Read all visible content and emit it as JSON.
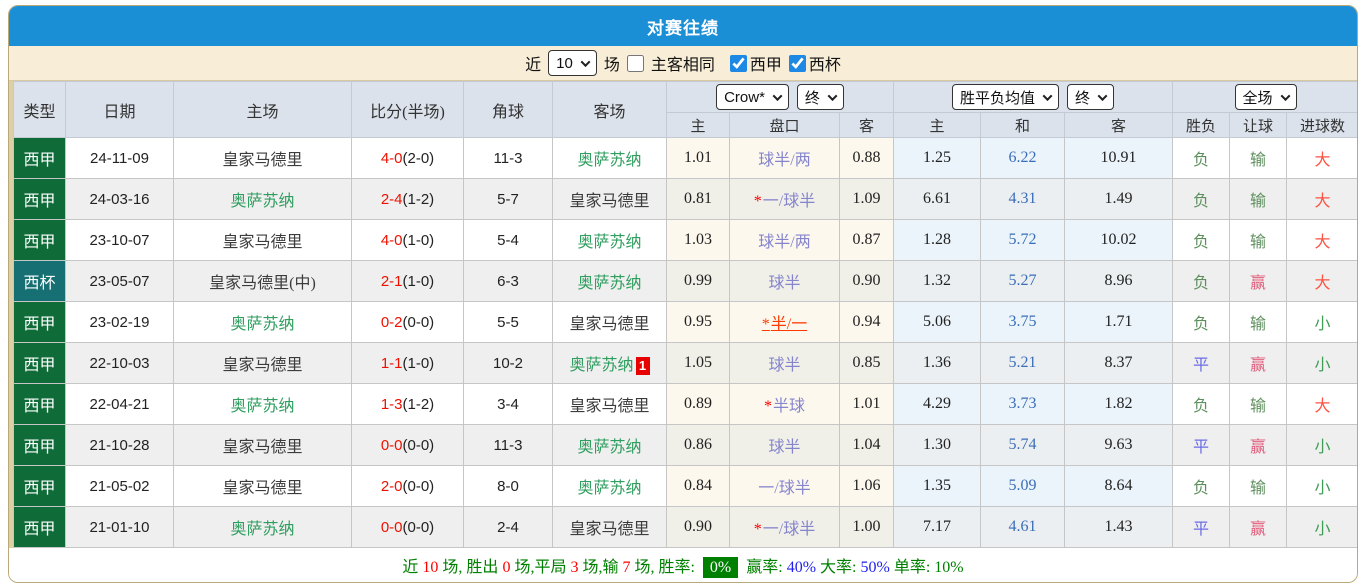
{
  "title": "对赛往绩",
  "colors": {
    "header_bar": "#1b8fd6",
    "filter_bar_bg": "#f8eed8",
    "liga_green": "#0f6c39",
    "cup_teal": "#166f73",
    "score_red": "#ee1100",
    "osasuna_green": "#2f9e5f",
    "handicap_purple": "#8585cd",
    "handicap_changed_red": "#ff3b00",
    "draw_avg_blue": "#3a6db8",
    "win_rate_badge_bg": "#008000"
  },
  "icons": {
    "dropdown_arrow": "chevron-down"
  },
  "filter": {
    "near_label": "近",
    "games_value": "10",
    "games_label": "场",
    "same_venue_label": "主客相同",
    "same_venue_checked": false,
    "league_label": "西甲",
    "league_checked": true,
    "cup_label": "西杯",
    "cup_checked": true
  },
  "table": {
    "left_headers": [
      "类型",
      "日期",
      "主场",
      "比分(半场)",
      "角球",
      "客场"
    ],
    "sub_headers": [
      "主",
      "盘口",
      "客",
      "主",
      "和",
      "客",
      "胜负",
      "让球",
      "进球数"
    ],
    "dropdowns": {
      "bookmaker": "Crow*",
      "bookmaker_state": "终",
      "avg": "胜平负均值",
      "avg_state": "终",
      "period": "全场"
    },
    "rows": [
      {
        "type": "西甲",
        "type_cls": "liga",
        "date": "24-11-09",
        "home": "皇家马德里",
        "home_cls": "black",
        "score": "4-0",
        "half": "(2-0)",
        "corner": "11-3",
        "away": "奥萨苏纳",
        "away_cls": "green",
        "red_card": "",
        "odds_home": "1.01",
        "line": "球半/两",
        "line_star": false,
        "line_changed": false,
        "odds_away": "0.88",
        "avg_home": "1.25",
        "avg_draw": "6.22",
        "avg_away": "10.91",
        "wl": "负",
        "wl_cls": "green",
        "let": "输",
        "let_cls": "green",
        "goal": "大",
        "goal_cls": "big"
      },
      {
        "type": "西甲",
        "type_cls": "liga",
        "date": "24-03-16",
        "home": "奥萨苏纳",
        "home_cls": "green",
        "score": "2-4",
        "half": "(1-2)",
        "corner": "5-7",
        "away": "皇家马德里",
        "away_cls": "black",
        "red_card": "",
        "odds_home": "0.81",
        "line": "一/球半",
        "line_star": true,
        "line_changed": false,
        "odds_away": "1.09",
        "avg_home": "6.61",
        "avg_draw": "4.31",
        "avg_away": "1.49",
        "wl": "负",
        "wl_cls": "green",
        "let": "输",
        "let_cls": "green",
        "goal": "大",
        "goal_cls": "big"
      },
      {
        "type": "西甲",
        "type_cls": "liga",
        "date": "23-10-07",
        "home": "皇家马德里",
        "home_cls": "black",
        "score": "4-0",
        "half": "(1-0)",
        "corner": "5-4",
        "away": "奥萨苏纳",
        "away_cls": "green",
        "red_card": "",
        "odds_home": "1.03",
        "line": "球半/两",
        "line_star": false,
        "line_changed": false,
        "odds_away": "0.87",
        "avg_home": "1.28",
        "avg_draw": "5.72",
        "avg_away": "10.02",
        "wl": "负",
        "wl_cls": "green",
        "let": "输",
        "let_cls": "green",
        "goal": "大",
        "goal_cls": "big"
      },
      {
        "type": "西杯",
        "type_cls": "cup",
        "date": "23-05-07",
        "home": "皇家马德里(中)",
        "home_cls": "black",
        "score": "2-1",
        "half": "(1-0)",
        "corner": "6-3",
        "away": "奥萨苏纳",
        "away_cls": "green",
        "red_card": "",
        "odds_home": "0.99",
        "line": "球半",
        "line_star": false,
        "line_changed": false,
        "odds_away": "0.90",
        "avg_home": "1.32",
        "avg_draw": "5.27",
        "avg_away": "8.96",
        "wl": "负",
        "wl_cls": "green",
        "let": "赢",
        "let_cls": "pink",
        "goal": "大",
        "goal_cls": "big"
      },
      {
        "type": "西甲",
        "type_cls": "liga",
        "date": "23-02-19",
        "home": "奥萨苏纳",
        "home_cls": "green",
        "score": "0-2",
        "half": "(0-0)",
        "corner": "5-5",
        "away": "皇家马德里",
        "away_cls": "black",
        "red_card": "",
        "odds_home": "0.95",
        "line": "半/一",
        "line_star": true,
        "line_changed": true,
        "odds_away": "0.94",
        "avg_home": "5.06",
        "avg_draw": "3.75",
        "avg_away": "1.71",
        "wl": "负",
        "wl_cls": "green",
        "let": "输",
        "let_cls": "green",
        "goal": "小",
        "goal_cls": "small"
      },
      {
        "type": "西甲",
        "type_cls": "liga",
        "date": "22-10-03",
        "home": "皇家马德里",
        "home_cls": "black",
        "score": "1-1",
        "half": "(1-0)",
        "corner": "10-2",
        "away": "奥萨苏纳",
        "away_cls": "green",
        "red_card": "1",
        "odds_home": "1.05",
        "line": "球半",
        "line_star": false,
        "line_changed": false,
        "odds_away": "0.85",
        "avg_home": "1.36",
        "avg_draw": "5.21",
        "avg_away": "8.37",
        "wl": "平",
        "wl_cls": "blue",
        "let": "赢",
        "let_cls": "pink",
        "goal": "小",
        "goal_cls": "small"
      },
      {
        "type": "西甲",
        "type_cls": "liga",
        "date": "22-04-21",
        "home": "奥萨苏纳",
        "home_cls": "green",
        "score": "1-3",
        "half": "(1-2)",
        "corner": "3-4",
        "away": "皇家马德里",
        "away_cls": "black",
        "red_card": "",
        "odds_home": "0.89",
        "line": "半球",
        "line_star": true,
        "line_changed": false,
        "odds_away": "1.01",
        "avg_home": "4.29",
        "avg_draw": "3.73",
        "avg_away": "1.82",
        "wl": "负",
        "wl_cls": "green",
        "let": "输",
        "let_cls": "green",
        "goal": "大",
        "goal_cls": "big"
      },
      {
        "type": "西甲",
        "type_cls": "liga",
        "date": "21-10-28",
        "home": "皇家马德里",
        "home_cls": "black",
        "score": "0-0",
        "half": "(0-0)",
        "corner": "11-3",
        "away": "奥萨苏纳",
        "away_cls": "green",
        "red_card": "",
        "odds_home": "0.86",
        "line": "球半",
        "line_star": false,
        "line_changed": false,
        "odds_away": "1.04",
        "avg_home": "1.30",
        "avg_draw": "5.74",
        "avg_away": "9.63",
        "wl": "平",
        "wl_cls": "blue",
        "let": "赢",
        "let_cls": "pink",
        "goal": "小",
        "goal_cls": "small"
      },
      {
        "type": "西甲",
        "type_cls": "liga",
        "date": "21-05-02",
        "home": "皇家马德里",
        "home_cls": "black",
        "score": "2-0",
        "half": "(0-0)",
        "corner": "8-0",
        "away": "奥萨苏纳",
        "away_cls": "green",
        "red_card": "",
        "odds_home": "0.84",
        "line": "一/球半",
        "line_star": false,
        "line_changed": false,
        "odds_away": "1.06",
        "avg_home": "1.35",
        "avg_draw": "5.09",
        "avg_away": "8.64",
        "wl": "负",
        "wl_cls": "green",
        "let": "输",
        "let_cls": "green",
        "goal": "小",
        "goal_cls": "small"
      },
      {
        "type": "西甲",
        "type_cls": "liga",
        "date": "21-01-10",
        "home": "奥萨苏纳",
        "home_cls": "green",
        "score": "0-0",
        "half": "(0-0)",
        "corner": "2-4",
        "away": "皇家马德里",
        "away_cls": "black",
        "red_card": "",
        "odds_home": "0.90",
        "line": "一/球半",
        "line_star": true,
        "line_changed": false,
        "odds_away": "1.00",
        "avg_home": "7.17",
        "avg_draw": "4.61",
        "avg_away": "1.43",
        "wl": "平",
        "wl_cls": "blue",
        "let": "赢",
        "let_cls": "pink",
        "goal": "小",
        "goal_cls": "small"
      }
    ]
  },
  "footer": {
    "parts": [
      {
        "text": "近 ",
        "cls": "grn",
        "name": "footer-label"
      },
      {
        "text": "10",
        "cls": "red",
        "name": "footer-total-games"
      },
      {
        "text": " 场, 胜出 ",
        "cls": "grn",
        "name": "footer-label"
      },
      {
        "text": "0",
        "cls": "red",
        "name": "footer-wins"
      },
      {
        "text": " 场,平局 ",
        "cls": "grn",
        "name": "footer-label"
      },
      {
        "text": "3",
        "cls": "red",
        "name": "footer-draws"
      },
      {
        "text": " 场,输 ",
        "cls": "grn",
        "name": "footer-label"
      },
      {
        "text": "7",
        "cls": "red",
        "name": "footer-losses"
      },
      {
        "text": " 场, 胜率: ",
        "cls": "grn",
        "name": "footer-label"
      },
      {
        "text": "0%",
        "cls": "badge",
        "name": "footer-win-rate-badge"
      },
      {
        "text": " 赢率: ",
        "cls": "grn",
        "name": "footer-label"
      },
      {
        "text": "40%",
        "cls": "blue",
        "name": "footer-handicap-rate"
      },
      {
        "text": " 大率: ",
        "cls": "grn",
        "name": "footer-label"
      },
      {
        "text": "50%",
        "cls": "blue",
        "name": "footer-over-rate"
      },
      {
        "text": " 单率: ",
        "cls": "grn",
        "name": "footer-label"
      },
      {
        "text": "10%",
        "cls": "grn",
        "name": "footer-odd-rate"
      }
    ]
  }
}
